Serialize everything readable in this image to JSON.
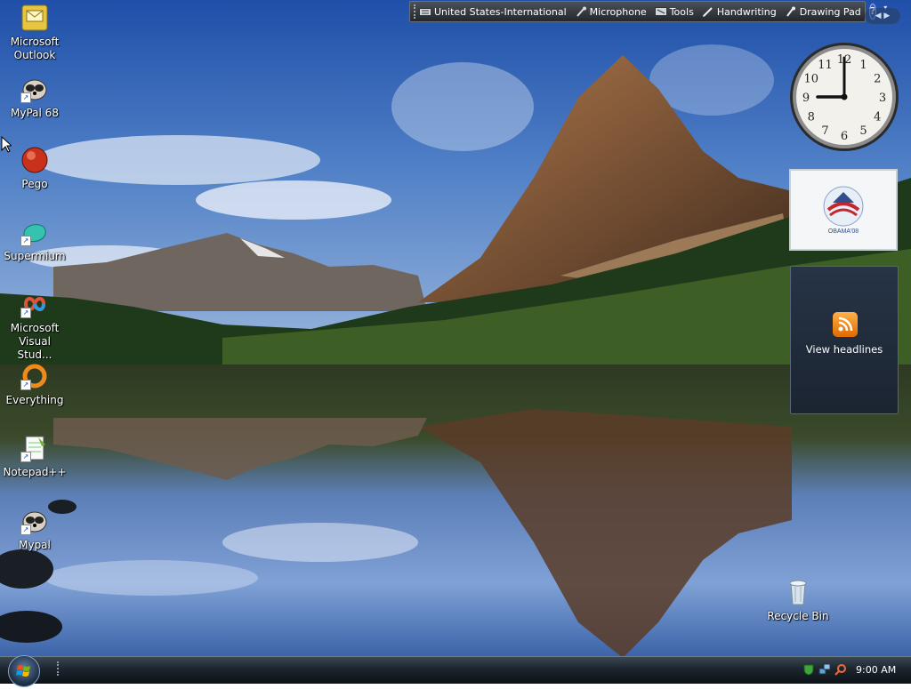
{
  "desktop": {
    "icons": [
      {
        "label": "Microsoft Outlook",
        "icon": "outlook-icon",
        "shortcut": false
      },
      {
        "label": "MyPal 68",
        "icon": "mypal-icon",
        "shortcut": true
      },
      {
        "label": "Pego",
        "icon": "pego-icon",
        "shortcut": false
      },
      {
        "label": "Supermium",
        "icon": "supermium-icon",
        "shortcut": true
      },
      {
        "label": "Microsoft Visual Stud...",
        "icon": "visual-studio-icon",
        "shortcut": true
      },
      {
        "label": "Everything",
        "icon": "everything-icon",
        "shortcut": true
      },
      {
        "label": "Notepad++",
        "icon": "notepad-plus-plus-icon",
        "shortcut": true
      },
      {
        "label": "Mypal",
        "icon": "mypal-icon",
        "shortcut": true
      }
    ],
    "recycle_bin": {
      "label": "Recycle Bin",
      "icon": "recycle-bin-icon"
    }
  },
  "language_bar": {
    "language": "United States-International",
    "microphone": "Microphone",
    "tools": "Tools",
    "handwriting": "Handwriting",
    "drawing_pad": "Drawing Pad",
    "help": "?"
  },
  "sidebar": {
    "clock": {
      "hour": 9,
      "minute": 0,
      "numerals": [
        "12",
        "1",
        "2",
        "3",
        "4",
        "5",
        "6",
        "7",
        "8",
        "9",
        "10",
        "11"
      ]
    },
    "slideshow": {
      "caption": "OBAMA'08"
    },
    "feed": {
      "link": "View headlines",
      "icon": "rss-icon"
    }
  },
  "taskbar": {
    "start_icon": "windows-logo-icon",
    "clock": "9:00 AM",
    "tray_icons": [
      "security-shield-icon",
      "network-icon",
      "search-icon"
    ]
  },
  "colors": {
    "taskbar": "#1c252e",
    "feed_bg": "#273446",
    "rss_orange": "#f08a1a"
  }
}
